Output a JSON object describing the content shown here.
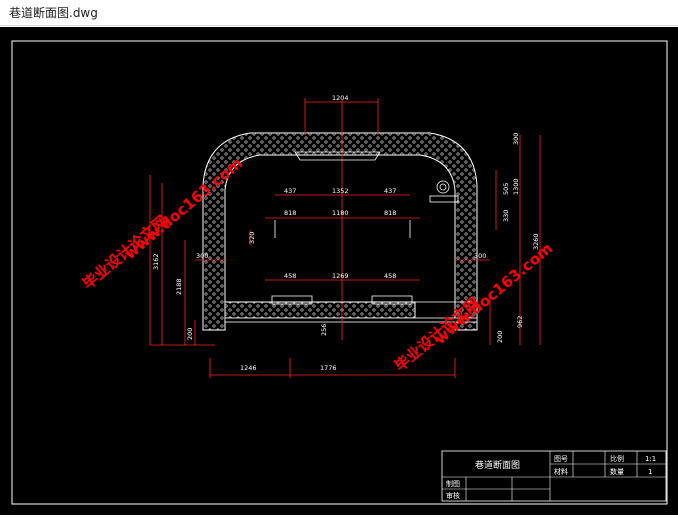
{
  "window": {
    "title": "巷道断面图.dwg"
  },
  "drawing": {
    "dimensions": {
      "top_width": "1204",
      "arch_thickness": "300",
      "left_lamp_offset": "437",
      "center_span": "1352",
      "right_lamp_offset": "437",
      "right_height_upper": "505",
      "right_height_mid": "1300",
      "right_height_low": "330",
      "left_pipe": "818",
      "pipe_span": "1180",
      "right_pipe": "818",
      "pipe_drop": "320",
      "overall_height_right": "3260",
      "left_height_1": "3162",
      "left_height_2": "2188",
      "left_wall": "300",
      "right_wall": "300",
      "rail_left": "458",
      "rail_span": "1269",
      "rail_right": "458",
      "track_height": "256",
      "right_low_1": "962",
      "right_low_2": "200",
      "floor_left": "200",
      "bottom_left": "1246",
      "bottom_right": "1776"
    },
    "watermarks": [
      "毕业设计论文网",
      "www.doc163.com"
    ]
  },
  "title_block": {
    "drawing_name": "巷道断面图",
    "label_drawing_no": "图号",
    "label_material": "材料",
    "label_scale": "比例",
    "scale_value": "1:1",
    "label_quantity": "数量",
    "quantity_value": "1",
    "label_drawn": "制图",
    "label_checked": "审核"
  },
  "colors": {
    "background": "#000000",
    "lines": "#ffffff",
    "dimensions": "#ff2020",
    "watermark": "#ff0000"
  }
}
